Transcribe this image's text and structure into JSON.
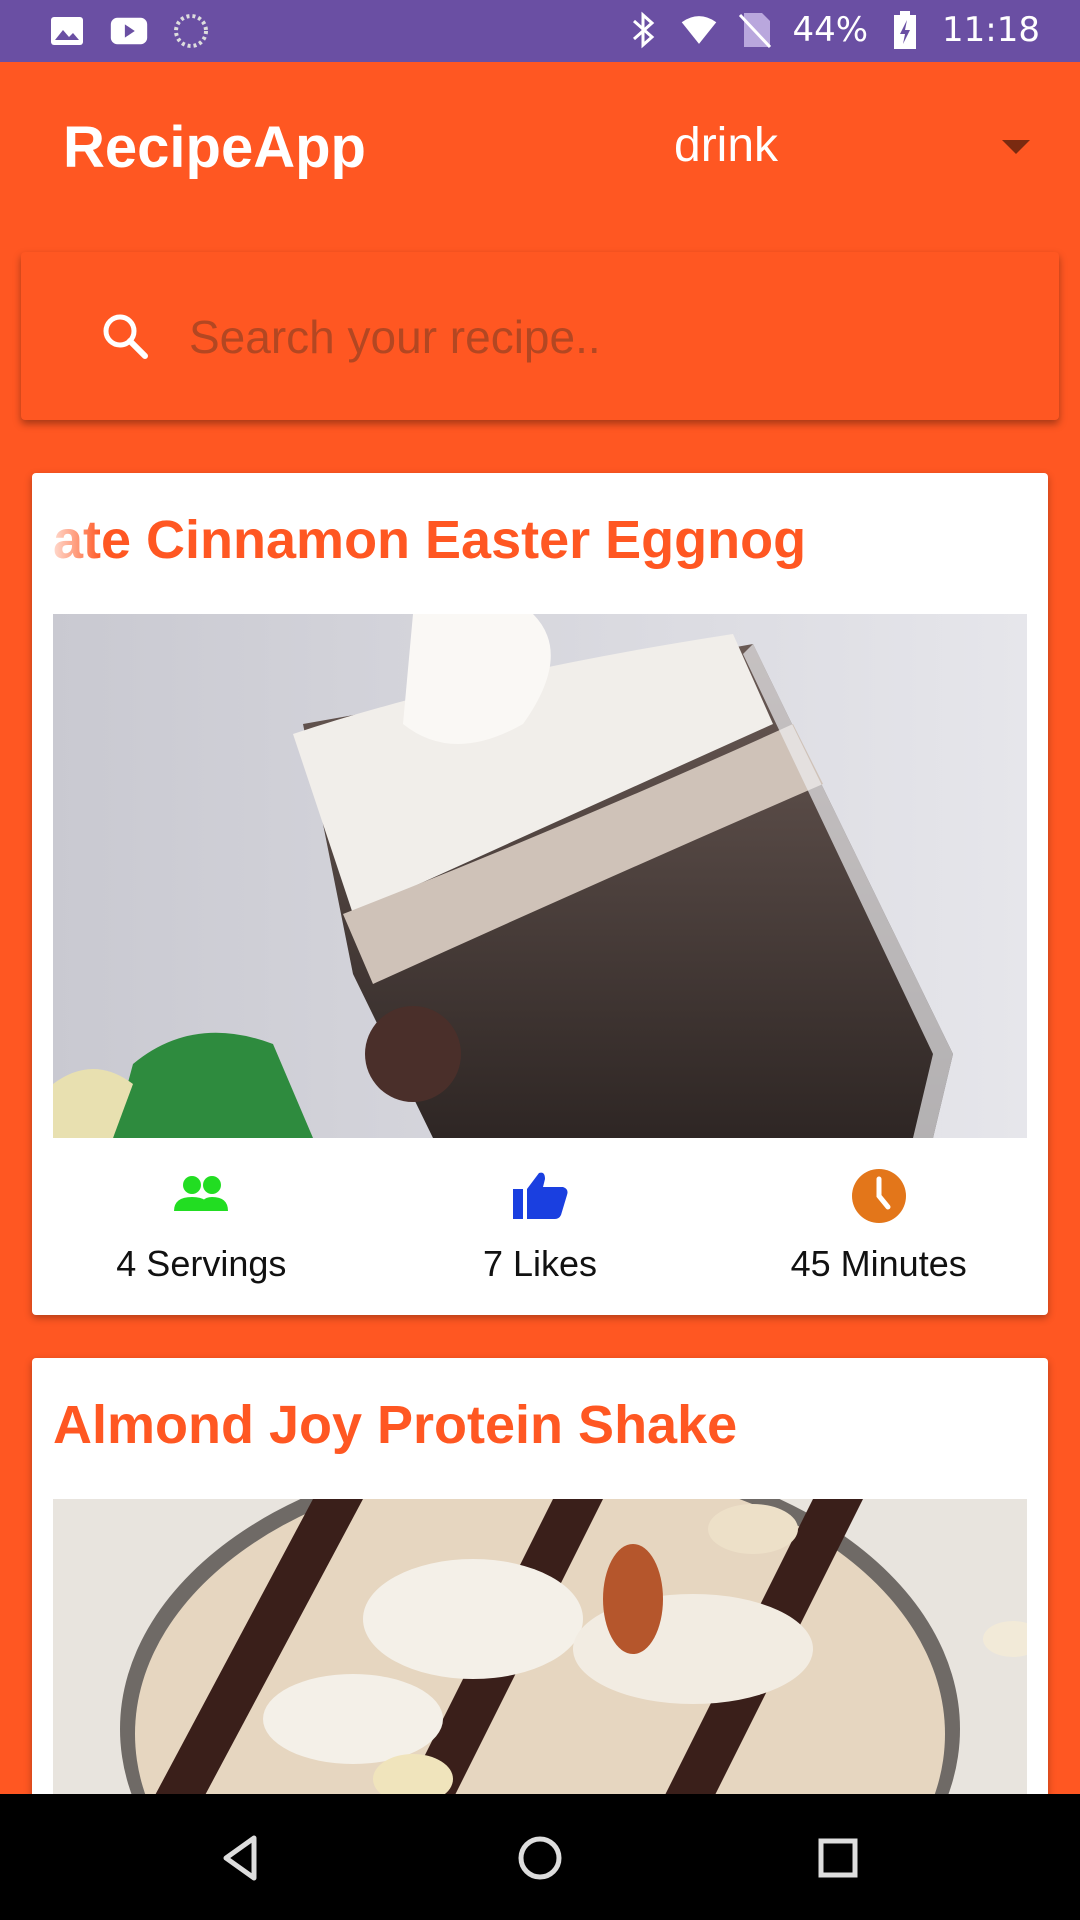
{
  "status_bar": {
    "battery": "44%",
    "time": "11:18"
  },
  "app_bar": {
    "title": "RecipeApp",
    "category_selected": "drink"
  },
  "search": {
    "placeholder": "Search your recipe.."
  },
  "recipes": [
    {
      "title": "ate Cinnamon Easter Eggnog",
      "servings": "4 Servings",
      "likes": "7 Likes",
      "time": "45 Minutes"
    },
    {
      "title": "Almond Joy Protein Shake"
    }
  ],
  "colors": {
    "primary": "#FF5722",
    "status_bar": "#6A4FA3",
    "servings_icon": "#22DD22",
    "likes_icon": "#1A3FE0",
    "time_icon": "#E3761A"
  },
  "icons": {
    "status_left": [
      "image-icon",
      "youtube-icon",
      "loading-icon"
    ],
    "status_right": [
      "bluetooth-icon",
      "wifi-icon",
      "no-sim-icon",
      "battery-icon"
    ],
    "search": "search-icon",
    "servings": "people-icon",
    "likes": "thumb-up-icon",
    "time": "clock-icon",
    "nav": [
      "back-icon",
      "home-icon",
      "recents-icon"
    ]
  }
}
